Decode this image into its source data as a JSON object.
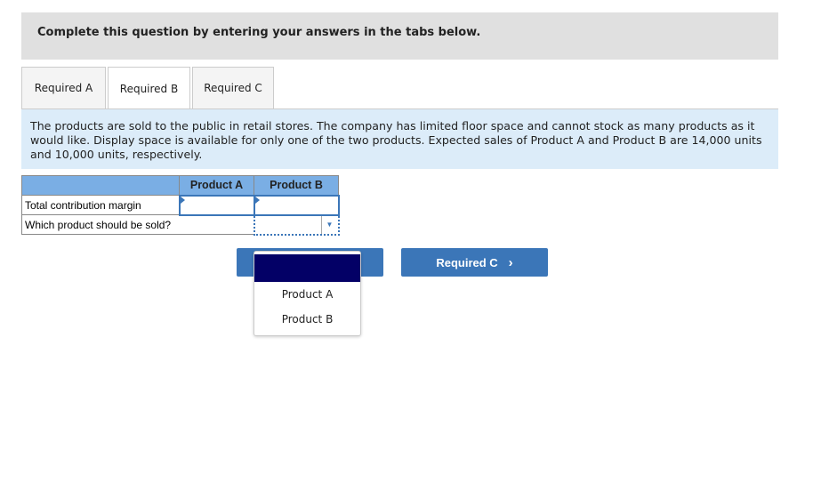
{
  "banner": {
    "text": "Complete this question by entering your answers in the tabs below."
  },
  "tabs": [
    {
      "label": "Required A"
    },
    {
      "label": "Required B",
      "active": true
    },
    {
      "label": "Required C"
    }
  ],
  "info": "The products are sold to the public in retail stores. The company has limited floor space and cannot stock as many products as it would like. Display space is available for only one of the two products. Expected sales of  Product A and Product B are 14,000 units and 10,000 units, respectively.",
  "table": {
    "headers": [
      "",
      "Product A",
      "Product B"
    ],
    "rows": [
      {
        "label": "Total contribution margin",
        "a": "",
        "b": ""
      },
      {
        "label": "Which product should be sold?",
        "value": ""
      }
    ]
  },
  "dropdown": {
    "options": [
      "",
      "Product A",
      "Product B"
    ]
  },
  "nav": {
    "next_label": "Required C",
    "next_icon": "chevron-right-icon"
  },
  "colors": {
    "accent": "#3b76b8",
    "header": "#7aaee4",
    "info_bg": "#dcecf9",
    "selected_option": "#030066"
  }
}
